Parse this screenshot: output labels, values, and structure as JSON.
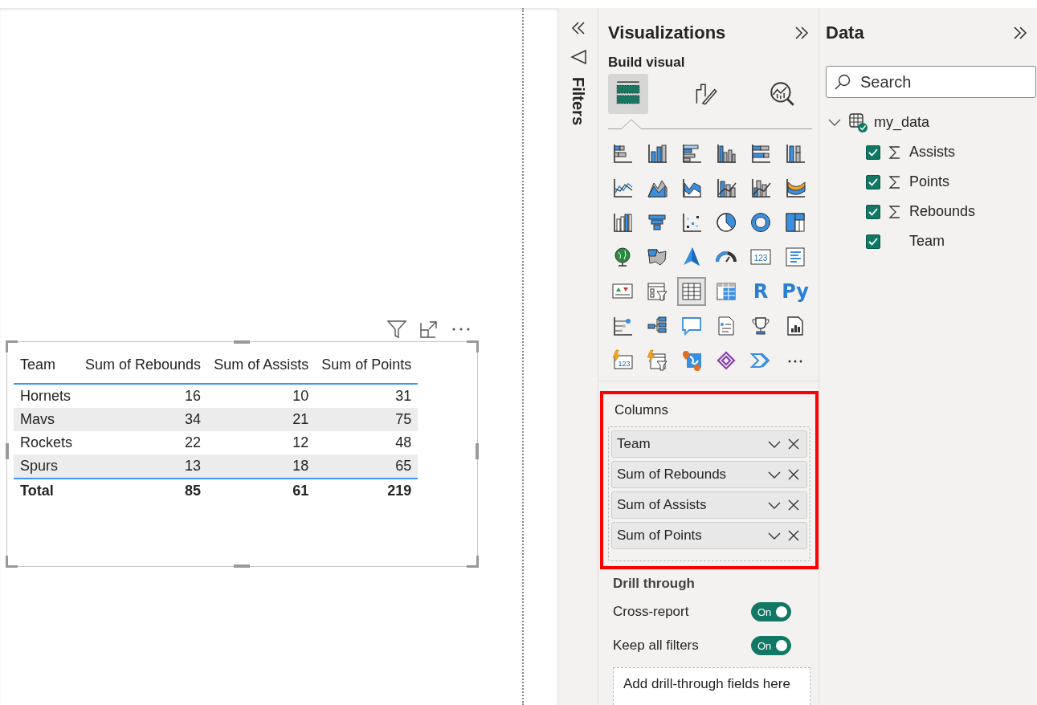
{
  "canvas": {
    "table_visual": {
      "columns": [
        "Team",
        "Sum of Rebounds",
        "Sum of Assists",
        "Sum of Points"
      ],
      "rows": [
        [
          "Hornets",
          "16",
          "10",
          "31"
        ],
        [
          "Mavs",
          "34",
          "21",
          "75"
        ],
        [
          "Rockets",
          "22",
          "12",
          "48"
        ],
        [
          "Spurs",
          "13",
          "18",
          "65"
        ]
      ],
      "total": [
        "Total",
        "85",
        "61",
        "219"
      ]
    }
  },
  "filters_pane": {
    "title": "Filters",
    "expanded": false
  },
  "visualizations": {
    "title": "Visualizations",
    "subtitle": "Build visual",
    "modes": [
      {
        "kind": "build",
        "selected": true
      },
      {
        "kind": "format",
        "selected": false
      },
      {
        "kind": "analytics",
        "selected": false
      }
    ],
    "visuals": [
      {
        "kind": "stacked-bar",
        "selected": false
      },
      {
        "kind": "stacked-column",
        "selected": false
      },
      {
        "kind": "clustered-bar",
        "selected": false
      },
      {
        "kind": "clustered-column",
        "selected": false
      },
      {
        "kind": "percent-bar",
        "selected": false
      },
      {
        "kind": "percent-column",
        "selected": false
      },
      {
        "kind": "line",
        "selected": false
      },
      {
        "kind": "area",
        "selected": false
      },
      {
        "kind": "stacked-area",
        "selected": false
      },
      {
        "kind": "line-column",
        "selected": false
      },
      {
        "kind": "line-clustered",
        "selected": false
      },
      {
        "kind": "ribbon",
        "selected": false
      },
      {
        "kind": "waterfall",
        "selected": false
      },
      {
        "kind": "funnel",
        "selected": false
      },
      {
        "kind": "scatter",
        "selected": false
      },
      {
        "kind": "pie",
        "selected": false
      },
      {
        "kind": "donut",
        "selected": false
      },
      {
        "kind": "treemap",
        "selected": false
      },
      {
        "kind": "globe",
        "selected": false
      },
      {
        "kind": "filled-map",
        "selected": false
      },
      {
        "kind": "arrow",
        "selected": false
      },
      {
        "kind": "gauge",
        "selected": false
      },
      {
        "kind": "card",
        "label": "123",
        "selected": false
      },
      {
        "kind": "multi-card",
        "selected": false
      },
      {
        "kind": "kpi",
        "selected": false
      },
      {
        "kind": "slicer",
        "selected": false
      },
      {
        "kind": "table",
        "selected": true
      },
      {
        "kind": "matrix",
        "selected": false
      },
      {
        "kind": "letter",
        "label": "R",
        "selected": false
      },
      {
        "kind": "letter",
        "label": "Py",
        "selected": false
      },
      {
        "kind": "influencers",
        "selected": false
      },
      {
        "kind": "decomposition",
        "selected": false
      },
      {
        "kind": "speech",
        "selected": false
      },
      {
        "kind": "narrative",
        "selected": false
      },
      {
        "kind": "trophy",
        "selected": false
      },
      {
        "kind": "paginated",
        "selected": false
      },
      {
        "kind": "power-card",
        "label": "123",
        "selected": false
      },
      {
        "kind": "power-slicer",
        "selected": false
      },
      {
        "kind": "azure-map",
        "selected": false
      },
      {
        "kind": "apps",
        "selected": false
      },
      {
        "kind": "automate",
        "selected": false
      },
      {
        "kind": "more",
        "selected": false
      }
    ],
    "columns_well": {
      "title": "Columns",
      "highlighted": true,
      "fields": [
        "Team",
        "Sum of Rebounds",
        "Sum of Assists",
        "Sum of Points"
      ]
    },
    "drill_through": {
      "title": "Drill through",
      "toggles": [
        {
          "label": "Cross-report",
          "on": true,
          "state_text": "On"
        },
        {
          "label": "Keep all filters",
          "on": true,
          "state_text": "On"
        }
      ],
      "drop_placeholder": "Add drill-through fields here"
    }
  },
  "data": {
    "title": "Data",
    "search": {
      "placeholder": "Search"
    },
    "tables": [
      {
        "name": "my_data",
        "expanded": true,
        "children": [
          {
            "name": "Assists",
            "kind": "measure",
            "checked": true
          },
          {
            "name": "Points",
            "kind": "measure",
            "checked": true
          },
          {
            "name": "Rebounds",
            "kind": "measure",
            "checked": true
          },
          {
            "name": "Team",
            "kind": "text",
            "checked": true
          }
        ]
      }
    ]
  }
}
